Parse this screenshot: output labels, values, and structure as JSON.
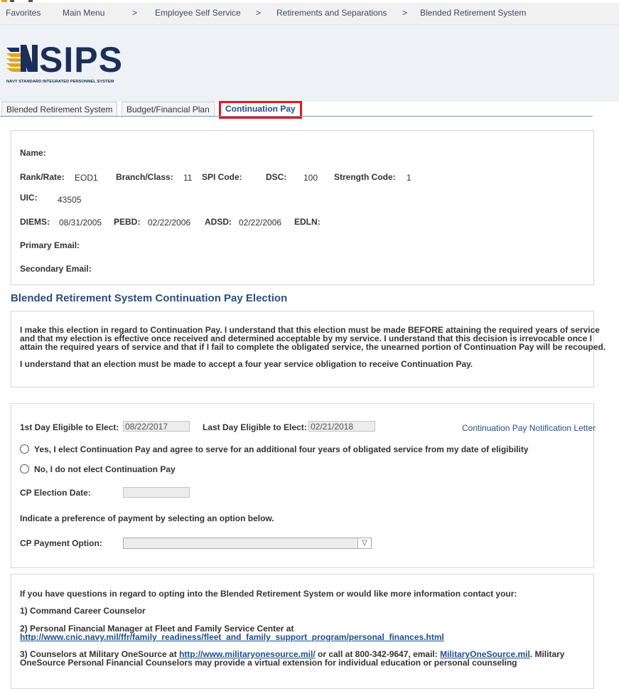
{
  "nav": {
    "favorites": "Favorites",
    "main_menu": "Main Menu",
    "crumbs": [
      "Employee Self Service",
      "Retirements and Separations",
      "Blended Retirement System"
    ],
    "separator": ">"
  },
  "logo": {
    "text": "NSIPS",
    "subtitle": "NAVY STANDARD INTEGRATED PERSONNEL SYSTEM"
  },
  "tabs": [
    {
      "label": "Blended Retirement System",
      "active": false
    },
    {
      "label": "Budget/Financial Plan",
      "active": false
    },
    {
      "label": "Continuation Pay",
      "active": true
    }
  ],
  "profile": {
    "name_label": "Name:",
    "name_value": "",
    "rank_label": "Rank/Rate:",
    "rank_value": "EOD1",
    "branch_label": "Branch/Class:",
    "branch_value": "11",
    "spi_label": "SPI Code:",
    "spi_value": "",
    "dsc_label": "DSC:",
    "dsc_value": "100",
    "strength_label": "Strength Code:",
    "strength_value": "1",
    "uic_label": "UIC:",
    "uic_value": "43505",
    "diems_label": "DIEMS:",
    "diems_value": "08/31/2005",
    "pebd_label": "PEBD:",
    "pebd_value": "02/22/2006",
    "adsd_label": "ADSD:",
    "adsd_value": "02/22/2006",
    "edln_label": "EDLN:",
    "edln_value": "",
    "primary_email_label": "Primary Email:",
    "secondary_email_label": "Secondary Email:"
  },
  "section_title": "Blended Retirement System Continuation Pay Election",
  "election_text": {
    "line1": "I make this election in regard to Continuation Pay. I understand that this election must be made BEFORE attaining the required years of service",
    "line2": "and that my election is effective once received and determined acceptable by my service. I understand that this decision is irrevocable once I",
    "line3": "attain the required years of service and that if I fail to complete the obligated service, the unearned portion of Continuation Pay will be recouped.",
    "line4": "I understand that an election must be made to accept a four year service obligation to receive Continuation Pay."
  },
  "form": {
    "first_day_label": "1st Day Eligible to Elect:",
    "first_day_value": "08/22/2017",
    "last_day_label": "Last Day Eligible to Elect:",
    "last_day_value": "02/21/2018",
    "notification_link": "Continuation Pay Notification Letter",
    "yes_option": "Yes, I elect Continuation Pay and agree to serve for an additional four years of obligated service from my date of eligibility",
    "no_option": "No, I do not elect Continuation Pay",
    "election_date_label": "CP Election Date:",
    "election_date_value": "",
    "preference_text": "Indicate a preference of payment by selecting an option below.",
    "payment_option_label": "CP Payment Option:",
    "payment_option_value": ""
  },
  "contact": {
    "intro": "If you have questions in regard to opting into the Blended Retirement System or would like more information contact your:",
    "item1": "1) Command Career Counselor",
    "item2_text": "2) Personal Financial Manager at Fleet and Family Service Center at",
    "item2_link": "http://www.cnic.navy.mil/ffr/family_readiness/fleet_and_family_support_program/personal_finances.html",
    "item3_pre": "3) Counselors at Military OneSource at ",
    "item3_link": "http://www.militaryonesource.mil/",
    "item3_mid": " or call at 800-342-9647, email: ",
    "item3_email": "MilitaryOneSource.mil",
    "item3_post": ". Military",
    "item3_line2": "OneSource Personal Financial Counselors may provide a virtual extension for individual education or personal counseling"
  }
}
